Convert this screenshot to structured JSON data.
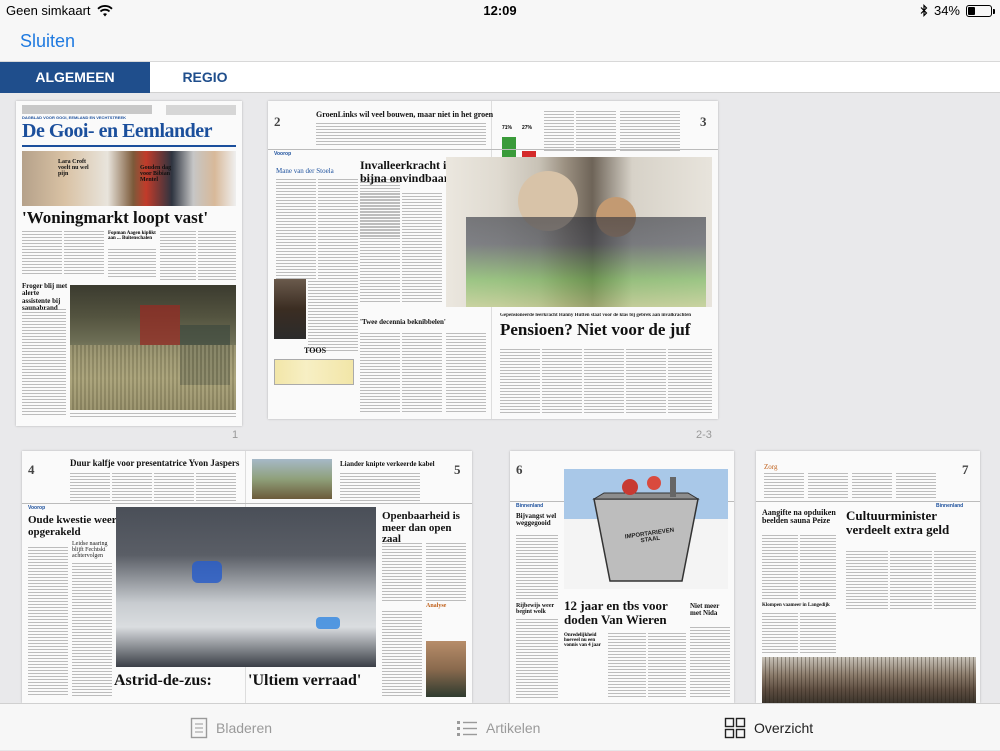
{
  "status": {
    "carrier": "Geen simkaart",
    "time": "12:09",
    "battery": "34%",
    "battery_level": 0.34
  },
  "nav": {
    "close_label": "Sluiten"
  },
  "tabs": [
    {
      "label": "ALGEMEEN",
      "active": true
    },
    {
      "label": "REGIO",
      "active": false
    }
  ],
  "pages": {
    "p1": {
      "number": "1",
      "masthead": "De Gooi- en Eemlander",
      "tagline": "DAGBLAD VOOR GOOI, EEMLAND EN VECHTSTREEK",
      "teaser1": "Lara Croft voelt nu wel pijn",
      "teaser2": "Gouden dag voor Bibian Mentel",
      "headline": "'Woningmarkt loopt vast'",
      "sub1": "Fopman Aagen kiplikt aan ... Buitenschalen",
      "left_head": "Froger blij met alerte assistente bij saunabrand"
    },
    "p23": {
      "number": "2-3",
      "left_num": "2",
      "right_num": "3",
      "top_head": "GroenLinks wil veel bouwen, maar niet in het groen",
      "sticker": "Voorop",
      "author": "Mane van der Stoela",
      "head2": "Invalleerkracht is bijna onvindbaar",
      "sub_head": "'Twee decennia beknibbelen'",
      "caption": "Gepensioneerde leerkracht Hanny Hutten staat voor de klas bij gebrek aan invalkrachten",
      "main_head": "Pensioen? Niet voor de juf",
      "cartoon_title": "TOOS",
      "poll_yes": "71%",
      "poll_no": "27%"
    },
    "p45": {
      "left_num": "4",
      "right_num": "5",
      "top_head": "Duur kalfje voor presentatrice Yvon Jaspers",
      "top_right": "Liander knipte verkeerde kabel",
      "left_head": "Oude kwestie weer opgerakeld",
      "left_sub": "Leidse naaring blijft Fechtski achtervolgen",
      "right_head": "Openbaarheid is meer dan open zaal",
      "analyse": "Analyse",
      "bottom_left": "Astrid-de-zus:",
      "bottom_right": "'Ultiem verraad'"
    },
    "p6": {
      "num": "6",
      "tag": "Binnenland",
      "head_a": "Bijvangst wel weggegooid",
      "head_b": "Rijbewijs weer begint wolk",
      "vat_label": "IMPORTARIEVEN STAAL",
      "main_head": "12 jaar en tbs voor doden Van Wieren",
      "sub": "Onredelijkheid hoeveel nu een vonnis van 4 jaar",
      "side_head": "Niet meer met Nida"
    },
    "p7": {
      "num": "7",
      "tag": "Binnenland",
      "kop": "Zorg",
      "head_a": "Aangifte na opduiken beelden sauna Peize",
      "head_b": "Klompen vaameer in Langedijk",
      "main_head": "Cultuurminister verdeelt extra geld"
    }
  },
  "bottom": {
    "browse": "Bladeren",
    "articles": "Artikelen",
    "overview": "Overzicht"
  },
  "colors": {
    "accent": "#1f7ae0",
    "tab_active": "#1f4e8c",
    "brand_blue": "#1b4f9c"
  }
}
